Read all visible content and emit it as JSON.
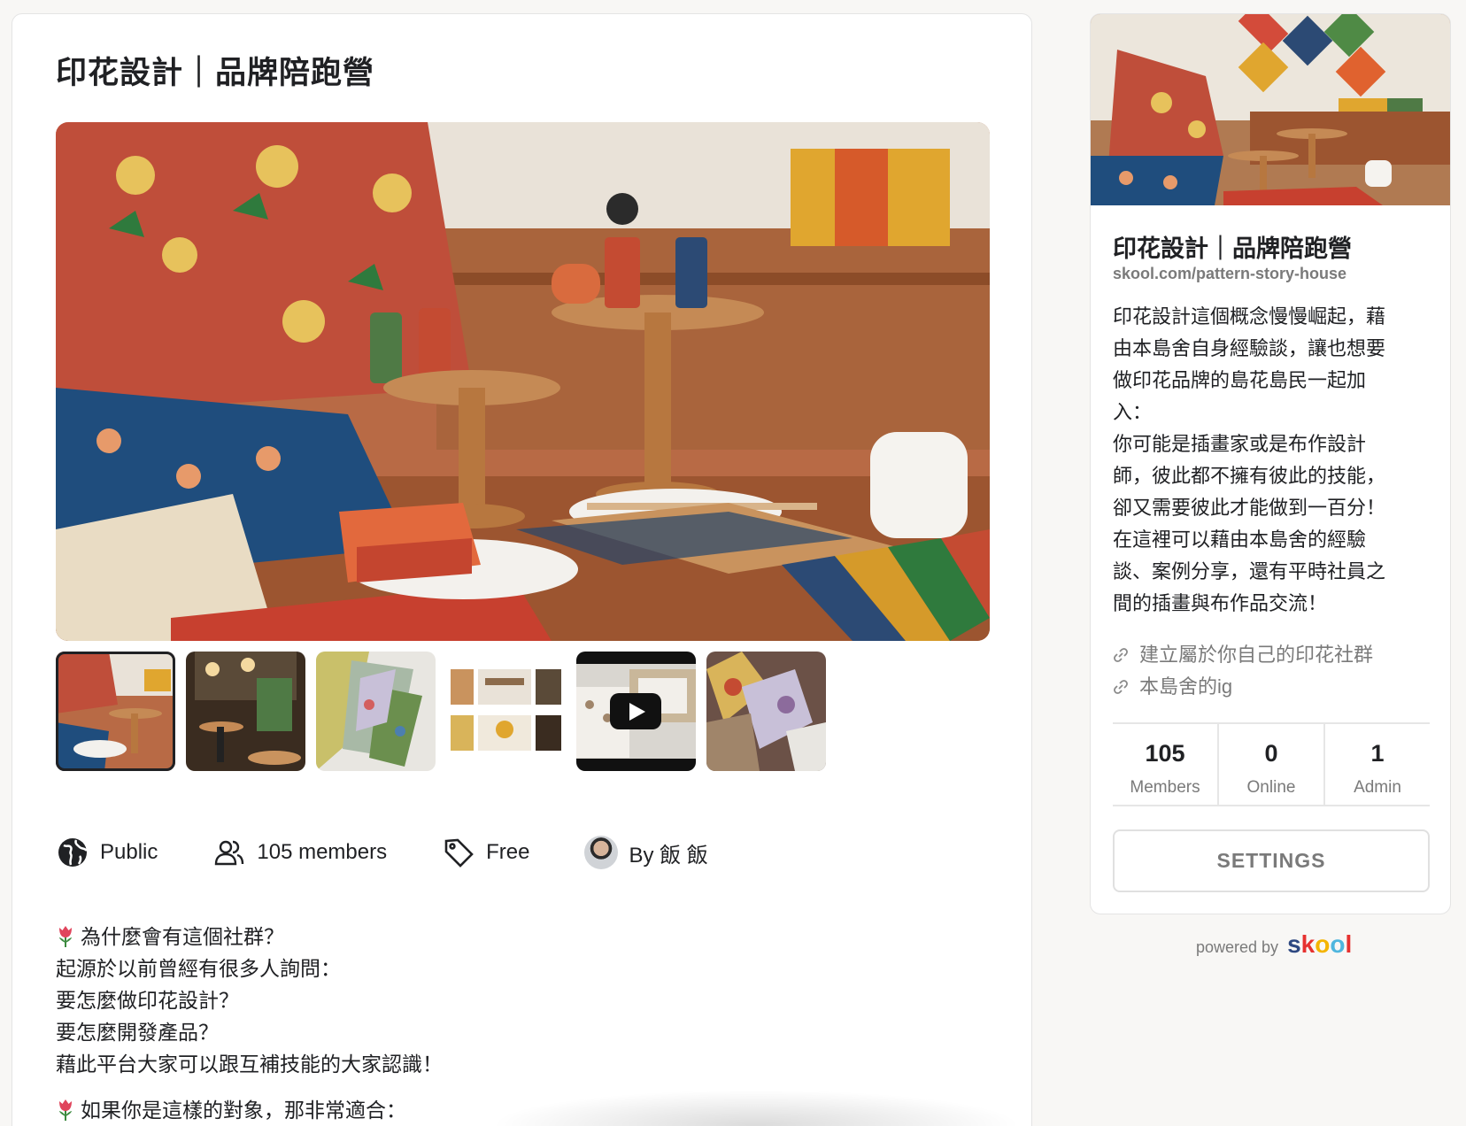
{
  "page": {
    "title": "印花設計｜品牌陪跑營"
  },
  "gallery": {
    "thumbnails": [
      {
        "kind": "photo",
        "selected": true
      },
      {
        "kind": "photo",
        "selected": false
      },
      {
        "kind": "photo",
        "selected": false
      },
      {
        "kind": "photo",
        "selected": false
      },
      {
        "kind": "video",
        "selected": false
      },
      {
        "kind": "photo",
        "selected": false
      }
    ]
  },
  "meta": {
    "privacy": "Public",
    "members": "105 members",
    "price": "Free",
    "owner": "By 飯 飯",
    "icons": [
      "globe-icon",
      "members-icon",
      "tag-icon",
      "avatar"
    ]
  },
  "description": {
    "lines_1": [
      "為什麼會有這個社群？",
      "起源於以前曾經有很多人詢問：",
      "要怎麼做印花設計？",
      "要怎麼開發產品？",
      "藉此平台大家可以跟互補技能的大家認識！"
    ],
    "lines_2": [
      "如果你是這樣的對象，那非常適合："
    ]
  },
  "sidebar": {
    "title": "印花設計｜品牌陪跑營",
    "url": "skool.com/pattern-story-house",
    "description_lines": [
      "印花設計這個概念慢慢崛起，藉",
      "由本島舍自身經驗談，讓也想要",
      "做印花品牌的島花島民一起加",
      "入：",
      "你可能是插畫家或是布作設計",
      "師，彼此都不擁有彼此的技能，",
      "卻又需要彼此才能做到一百分！",
      "在這裡可以藉由本島舍的經驗",
      "談、案例分享，還有平時社員之",
      "間的插畫與布作品交流！"
    ],
    "links": [
      "建立屬於你自己的印花社群",
      "本島舍的ig"
    ],
    "stats": [
      {
        "value": "105",
        "label": "Members"
      },
      {
        "value": "0",
        "label": "Online"
      },
      {
        "value": "1",
        "label": "Admin"
      }
    ],
    "settings_label": "SETTINGS"
  },
  "footer": {
    "powered_by": "powered by",
    "brand": "skool",
    "brand_colors": [
      "#2e4881",
      "#e6312f",
      "#f4b400",
      "#4fb6de",
      "#e6312f"
    ]
  }
}
